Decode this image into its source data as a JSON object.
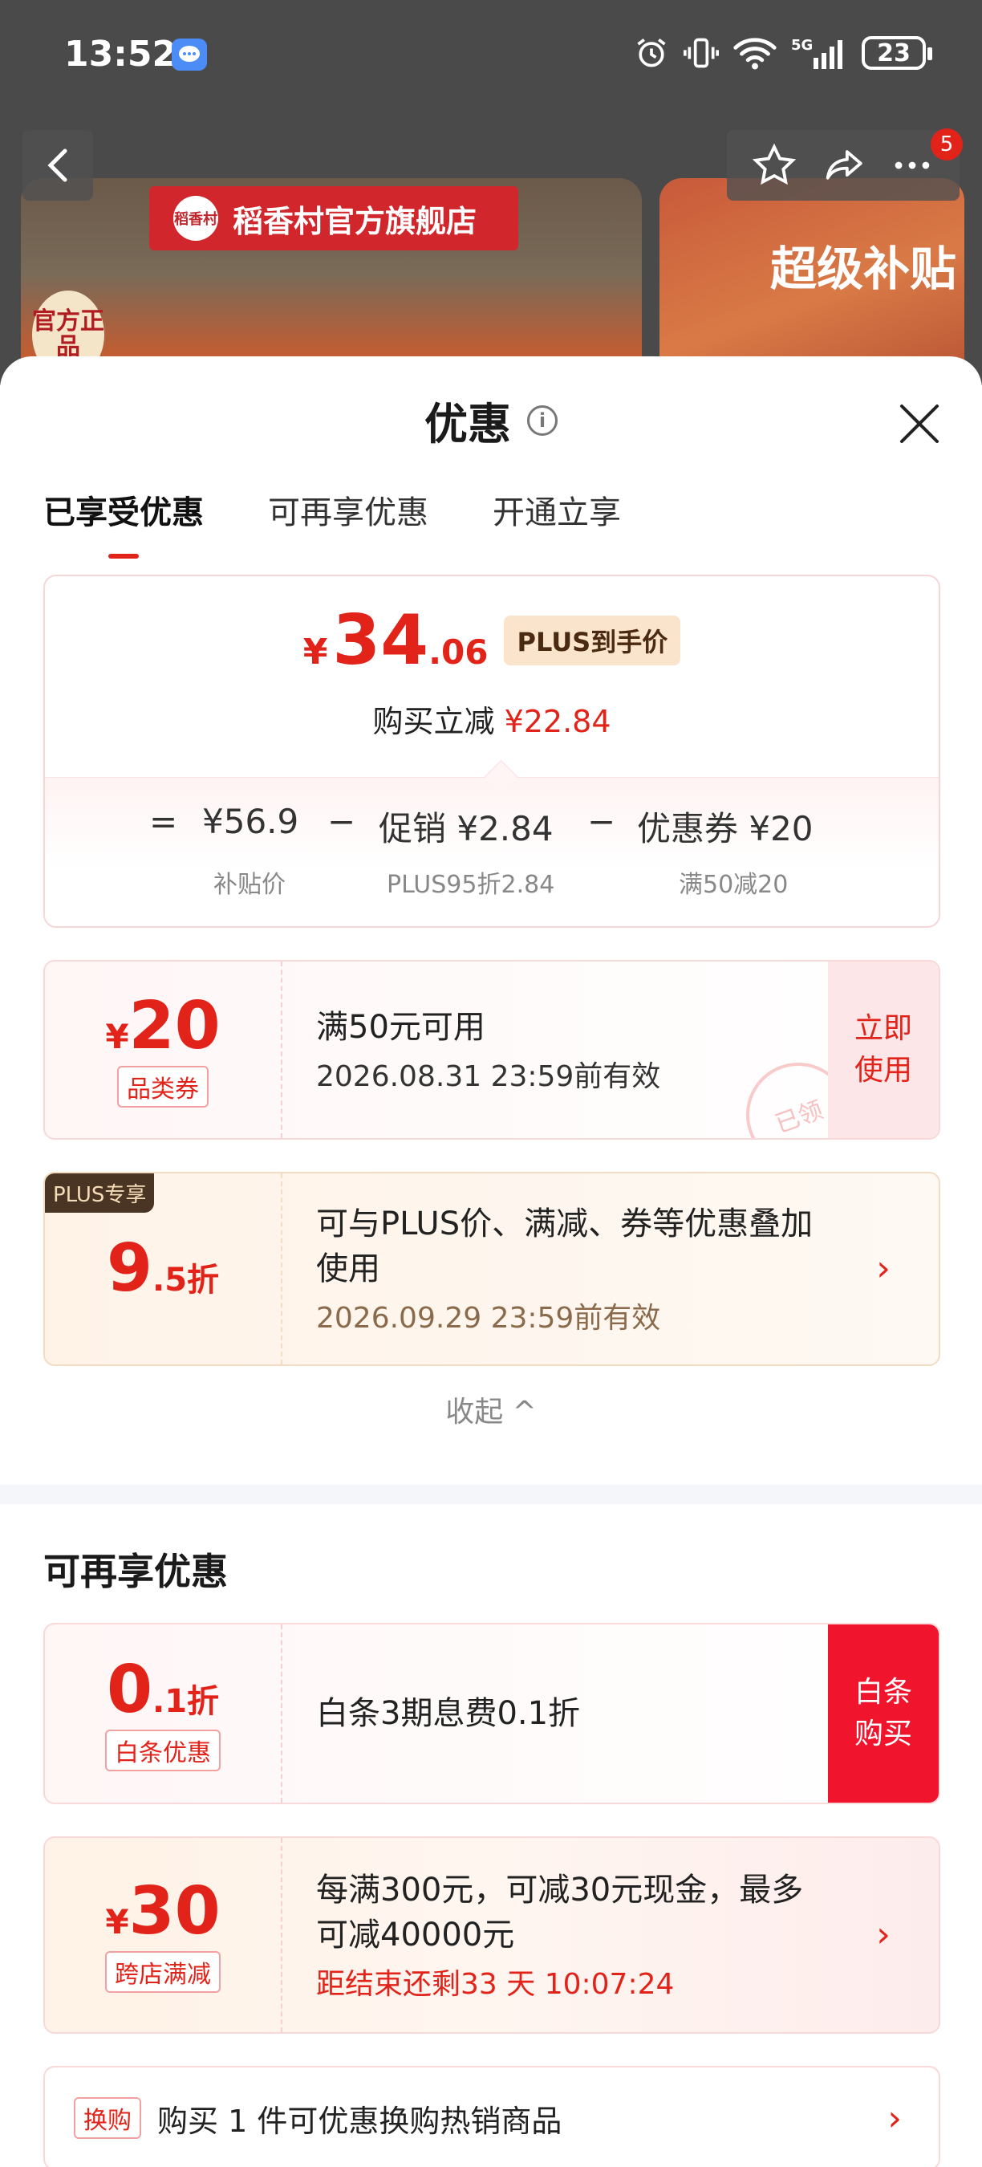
{
  "status_bar": {
    "time": "13:52",
    "battery": "23"
  },
  "background": {
    "store_name": "稻香村官方旗舰店",
    "store_logo": "稻香村",
    "official_badge": "官方正品",
    "promo_text": "超级补贴",
    "notification_count": "5"
  },
  "sheet": {
    "title": "优惠",
    "tabs": [
      {
        "label": "已享受优惠",
        "active": true
      },
      {
        "label": "可再享优惠",
        "active": false
      },
      {
        "label": "开通立享",
        "active": false
      }
    ]
  },
  "price": {
    "yen": "¥",
    "integer": "34",
    "decimal": ".06",
    "plus_tag": "PLUS到手价",
    "reduce_label": "购买立减",
    "reduce_value": "¥22.84",
    "formula": {
      "eq": "=",
      "base": "¥56.9",
      "minus1": "−",
      "promo": "促销 ¥2.84",
      "minus2": "−",
      "coupon": "优惠券 ¥20"
    },
    "sublabels": {
      "base": "补贴价",
      "promo": "PLUS95折2.84",
      "coupon": "满50减20"
    }
  },
  "coupon_category": {
    "sym": "¥",
    "amount": "20",
    "label": "品类券",
    "condition": "满50元可用",
    "expiry": "2026.08.31 23:59前有效",
    "action": "立即使用",
    "stamp": "已领"
  },
  "coupon_plus": {
    "badge": "PLUS专享",
    "amount": "9",
    "suffix": ".5折",
    "desc": "可与PLUS价、满减、券等优惠叠加使用",
    "expiry": "2026.09.29 23:59前有效",
    "chevron": "›"
  },
  "collapse_label": "收起 ^",
  "section2": {
    "title": "可再享优惠"
  },
  "coupon_baitiao": {
    "amount": "0",
    "suffix": ".1折",
    "label": "白条优惠",
    "desc": "白条3期息费0.1折",
    "action": "白条购买"
  },
  "coupon_cross": {
    "sym": "¥",
    "amount": "30",
    "label": "跨店满减",
    "desc": "每满300元，可减30元现金，最多可减40000元",
    "countdown": "距结束还剩33 天 10:07:24",
    "chevron": "›"
  },
  "exchange": {
    "tag": "换购",
    "text": "购买 1 件可优惠换购热销商品",
    "chevron": "›"
  }
}
